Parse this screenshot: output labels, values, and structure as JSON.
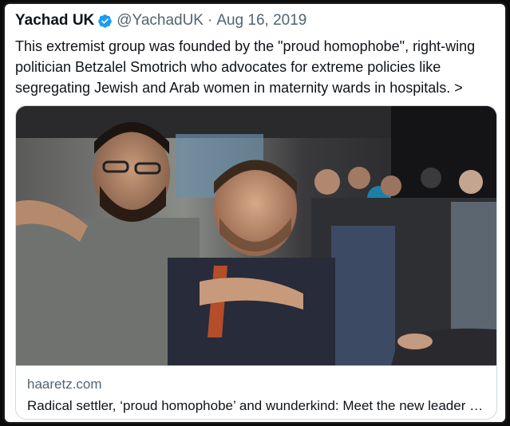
{
  "tweet": {
    "author_name": "Yachad UK",
    "verified_icon": "verified-badge-icon",
    "handle": "@YachadUK",
    "separator": "·",
    "date": "Aug 16, 2019",
    "text": "This extremist group was founded by the \"proud homophobe\", right-wing politician Betzalel Smotrich who advocates for extreme policies like segregating Jewish and Arab women in maternity wards in hospitals. >"
  },
  "link_card": {
    "domain": "haaretz.com",
    "title": "Radical settler, ‘proud homophobe’ and wunderkind: Meet the new leader of Israel's far right",
    "image_subject": "photo-crowd-embrace"
  },
  "colors": {
    "verified_blue": "#1d9bf0",
    "text_primary": "#0f1419",
    "text_secondary": "#536471",
    "border": "#cfd9de"
  }
}
